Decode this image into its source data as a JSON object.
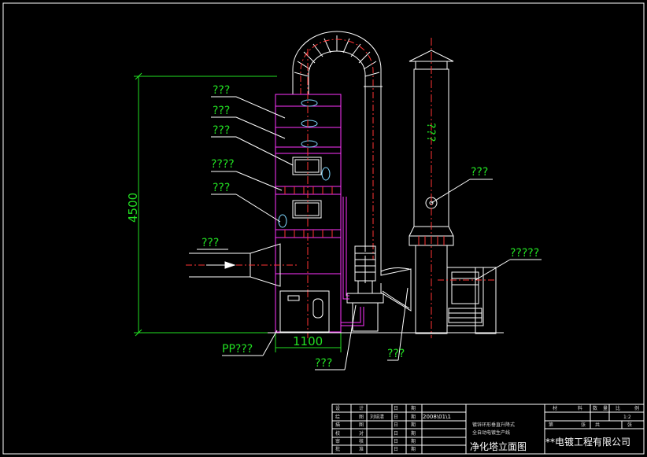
{
  "labels": {
    "spray_layer_1": "???",
    "spray_layer_2": "???",
    "spray_layer_3": "???",
    "inspection_window": "????",
    "packing_layer": "???",
    "air_inlet": "???",
    "tank_material": "PP???",
    "pump": "???",
    "exhaust_stack_body": "???",
    "stack_port": "???",
    "fan": "?????",
    "duct": "???"
  },
  "dimensions": {
    "height": "4500",
    "width": "1100"
  },
  "title_block": {
    "row_labels": [
      "设",
      "绘",
      "描",
      "校",
      "审",
      "批"
    ],
    "row_sublabels": [
      "计",
      "图",
      "图",
      "对",
      "核",
      "准"
    ],
    "date_label": "日",
    "date_label2": "期",
    "drafter_name": "刘结清",
    "date_value": "2008\\01\\1",
    "project_line1": "镀锌环形垂直升降式",
    "project_line2": "全自动电镀生产线",
    "drawing_title": "净化塔立面图",
    "material_label": "材",
    "material_label2": "料",
    "qty_label": "数",
    "qty_label2": "量",
    "scale_label": "比",
    "scale_label2": "例",
    "scale_value": "1:2",
    "sheet_no": "第",
    "sheet_total": "共",
    "sheet_unit": "张",
    "sheet_unit2": "张",
    "company": "**电镀工程有限公司"
  },
  "colors": {
    "tower": "#ff33ff",
    "label": "#22e022",
    "line": "#ffffff",
    "centerline": "#ff3333",
    "grid": "#ff3333",
    "dimension": "#22e022",
    "background": "#000000"
  }
}
